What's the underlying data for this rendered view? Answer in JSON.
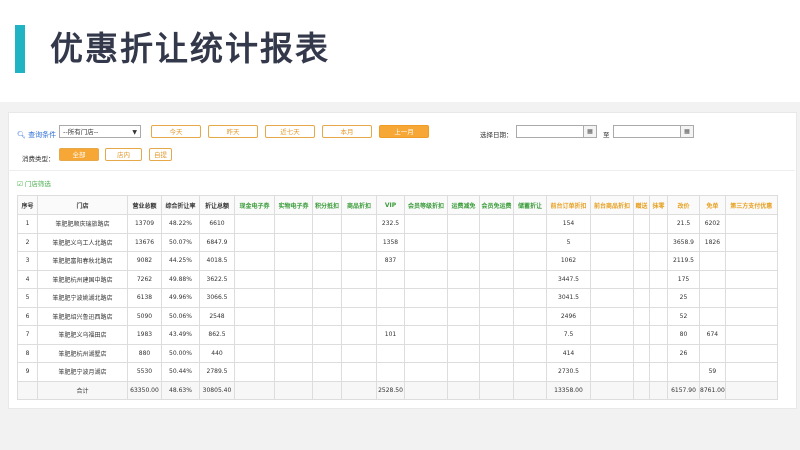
{
  "page_title": "优惠折让统计报表",
  "filters": {
    "search_label": "查询条件",
    "store_select": "--所有门店--",
    "range_buttons": [
      "今天",
      "昨天",
      "近七天",
      "本月",
      "上一月"
    ],
    "active_range": "上一月",
    "date_label": "选择日期：",
    "date_to": "至",
    "consume_label": "消费类型：",
    "consume_buttons": [
      "全部",
      "店内",
      "自提"
    ],
    "active_consume": "全部"
  },
  "store_filter_link": "门店筛选",
  "table": {
    "headers": [
      "序号",
      "门店",
      "营业总额",
      "综合折让率",
      "折让总额",
      "现金电子券",
      "实物电子券",
      "积分抵扣",
      "商品折扣",
      "VIP",
      "会员等级折扣",
      "运费减免",
      "会员免运费",
      "储蓄折让",
      "前台订单折扣",
      "前台商品折扣",
      "赠送",
      "抹零",
      "改价",
      "免单",
      "第三方支付优惠"
    ],
    "rows": [
      [
        "1",
        "笨肥肥顺庆瑞旅路店",
        "13709",
        "48.22%",
        "6610",
        "",
        "",
        "",
        "",
        "232.5",
        "",
        "",
        "",
        "",
        "154",
        "",
        "",
        "",
        "21.5",
        "6202",
        ""
      ],
      [
        "2",
        "笨肥肥义乌工人北路店",
        "13676",
        "50.07%",
        "6847.9",
        "",
        "",
        "",
        "",
        "1358",
        "",
        "",
        "",
        "",
        "5",
        "",
        "",
        "",
        "3658.9",
        "1826",
        ""
      ],
      [
        "3",
        "笨肥肥富阳春秋北路店",
        "9082",
        "44.25%",
        "4018.5",
        "",
        "",
        "",
        "",
        "837",
        "",
        "",
        "",
        "",
        "1062",
        "",
        "",
        "",
        "2119.5",
        "",
        ""
      ],
      [
        "4",
        "笨肥肥杭州建国中路店",
        "7262",
        "49.88%",
        "3622.5",
        "",
        "",
        "",
        "",
        "",
        "",
        "",
        "",
        "",
        "3447.5",
        "",
        "",
        "",
        "175",
        "",
        ""
      ],
      [
        "5",
        "笨肥肥宁波姚湖北路店",
        "6138",
        "49.96%",
        "3066.5",
        "",
        "",
        "",
        "",
        "",
        "",
        "",
        "",
        "",
        "3041.5",
        "",
        "",
        "",
        "25",
        "",
        ""
      ],
      [
        "6",
        "笨肥肥绍兴鲁迅西路店",
        "5090",
        "50.06%",
        "2548",
        "",
        "",
        "",
        "",
        "",
        "",
        "",
        "",
        "",
        "2496",
        "",
        "",
        "",
        "52",
        "",
        ""
      ],
      [
        "7",
        "笨肥肥义乌福田店",
        "1983",
        "43.49%",
        "862.5",
        "",
        "",
        "",
        "",
        "101",
        "",
        "",
        "",
        "",
        "7.5",
        "",
        "",
        "",
        "80",
        "674",
        ""
      ],
      [
        "8",
        "笨肥肥杭州湖墅店",
        "880",
        "50.00%",
        "440",
        "",
        "",
        "",
        "",
        "",
        "",
        "",
        "",
        "",
        "414",
        "",
        "",
        "",
        "26",
        "",
        ""
      ],
      [
        "9",
        "笨肥肥宁波月湖店",
        "5530",
        "50.44%",
        "2789.5",
        "",
        "",
        "",
        "",
        "",
        "",
        "",
        "",
        "",
        "2730.5",
        "",
        "",
        "",
        "",
        "59",
        ""
      ]
    ],
    "total": [
      "",
      "合计",
      "63350.00",
      "48.63%",
      "30805.40",
      "",
      "",
      "",
      "",
      "2528.50",
      "",
      "",
      "",
      "",
      "13358.00",
      "",
      "",
      "",
      "6157.90",
      "8761.00",
      ""
    ]
  }
}
